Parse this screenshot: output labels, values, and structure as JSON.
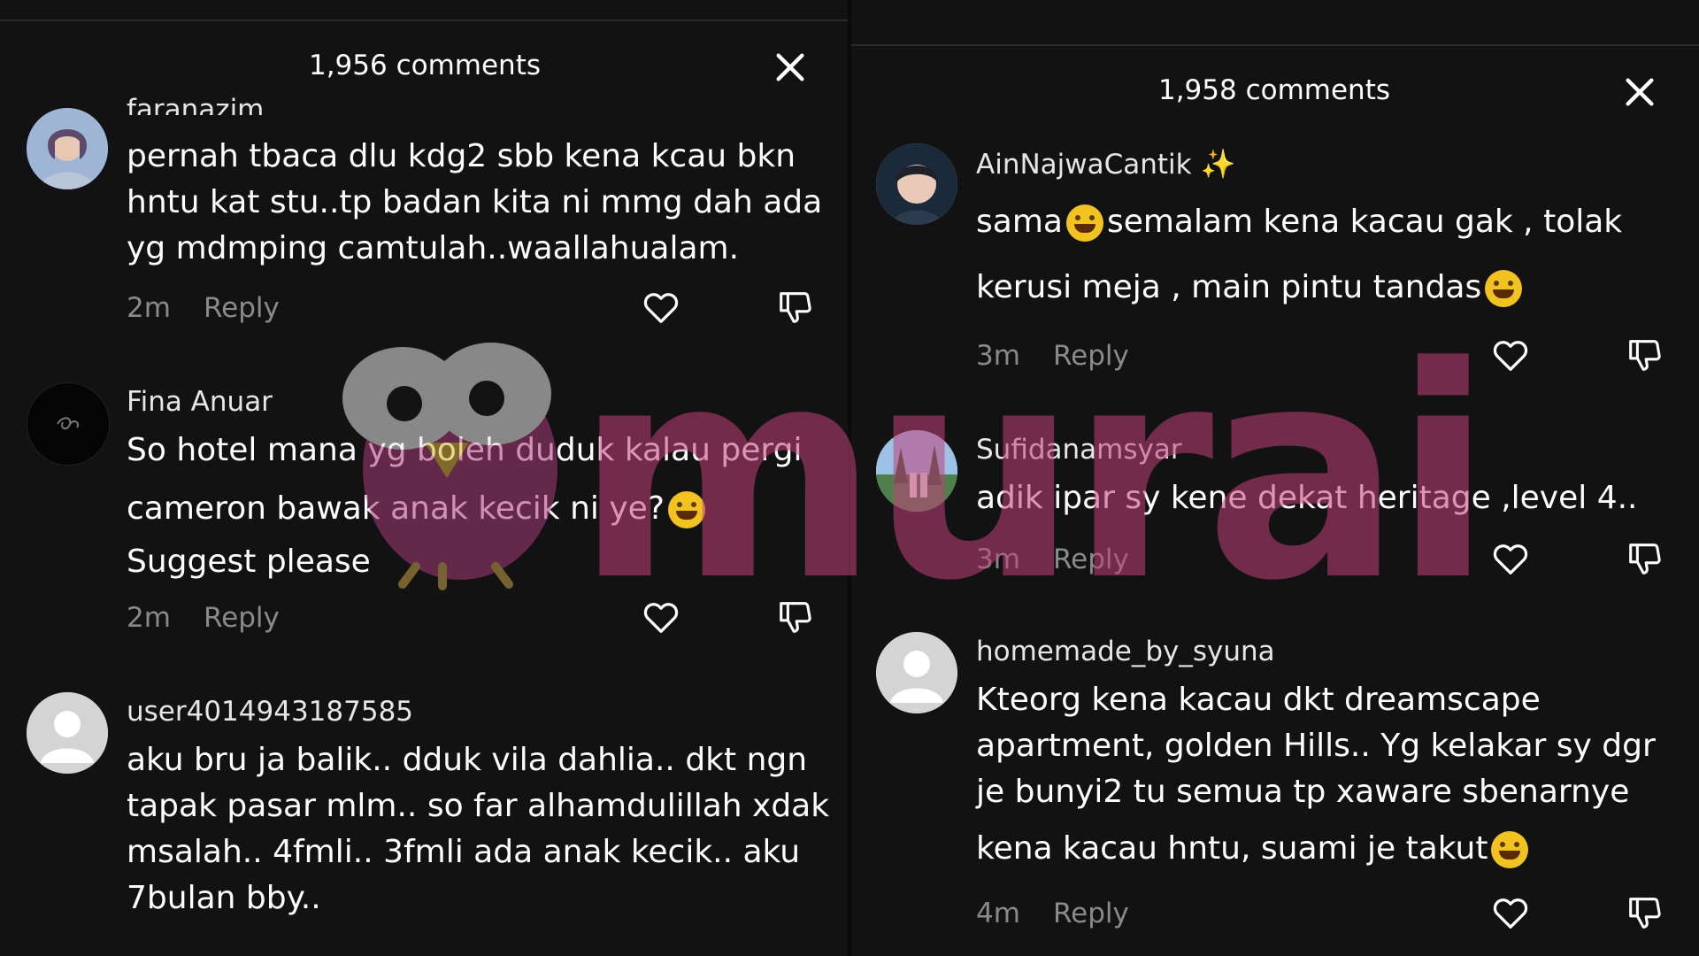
{
  "left": {
    "header_title": "1,956 comments",
    "comments": [
      {
        "username": "faranazim",
        "lines": [
          "pernah tbaca dlu kdg2 sbb kena kcau bkn",
          "hntu kat stu..tp badan kita ni mmg dah ada",
          "yg mdmping camtulah..waallahualam."
        ],
        "time": "2m",
        "reply": "Reply"
      },
      {
        "username": "Fina Anuar",
        "lines": [
          "So hotel mana yg boleh duduk kalau pergi",
          "cameron bawak anak kecik ni ye?",
          "Suggest please"
        ],
        "time": "2m",
        "reply": "Reply"
      },
      {
        "username": "user4014943187585",
        "lines": [
          "aku bru ja balik.. dduk vila dahlia.. dkt ngn",
          "tapak pasar mlm.. so far alhamdulillah xdak",
          "msalah.. 4fmli.. 3fmli ada anak kecik.. aku",
          "7bulan bby.."
        ]
      }
    ]
  },
  "right": {
    "header_title": "1,958 comments",
    "comments": [
      {
        "username": "AinNajwaCantik",
        "lines": [
          "sama",
          "semalam kena kacau gak , tolak",
          "kerusi meja , main pintu tandas"
        ],
        "time": "3m",
        "reply": "Reply"
      },
      {
        "username": "Sufidanamsyar",
        "lines": [
          "adik ipar sy kene dekat heritage ,level 4.."
        ],
        "time": "3m",
        "reply": "Reply"
      },
      {
        "username": "homemade_by_syuna",
        "lines": [
          "Kteorg kena kacau dkt dreamscape",
          "apartment, golden Hills.. Yg kelakar sy dgr",
          "je bunyi2 tu semua tp xaware sbenarnye",
          "kena kacau hntu, suami je takut"
        ],
        "time": "4m",
        "reply": "Reply"
      }
    ]
  },
  "watermark": {
    "text": "murai"
  },
  "icons": {
    "close": "close-icon",
    "like": "heart-outline-icon",
    "dislike": "thumbs-down-outline-icon",
    "emojis": [
      "grinning-sweat-emoji",
      "rolling-on-floor-laughing-emoji",
      "laughing-squinting-emoji",
      "tears-of-joy-emoji",
      "sparkles-emoji"
    ]
  },
  "colors": {
    "background": "#121212",
    "text": "#ffffff",
    "muted": "#8a8a8a",
    "watermark": "#c2407a"
  }
}
